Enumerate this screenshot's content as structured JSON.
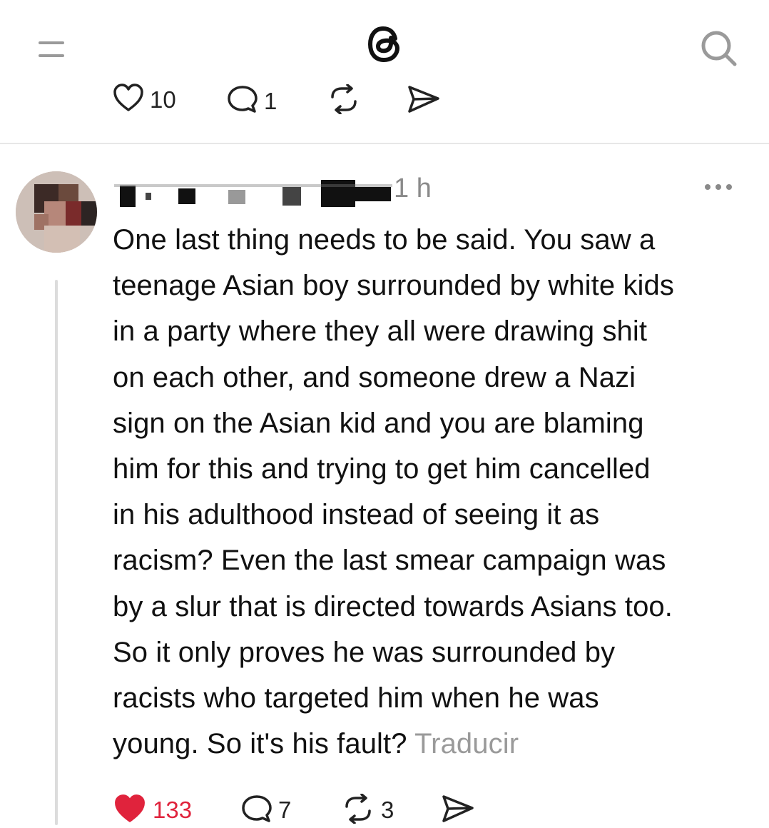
{
  "header": {
    "menu_icon": "menu-icon",
    "logo_icon": "threads-logo-icon",
    "search_icon": "search-icon"
  },
  "previous_post": {
    "likes": "10",
    "replies": "1",
    "repost_icon": "repost-icon",
    "share_icon": "share-icon"
  },
  "post": {
    "time": "1 h",
    "text_main": "One last thing needs to be said. You saw a\nteenage Asian boy surrounded by white kids\nin a party where they all were drawing shit\non each other, and someone drew a Nazi\nsign on the Asian kid and you are blaming\nhim for this and trying to get him cancelled\nin his adulthood instead of seeing it as\nracism? Even the last smear campaign was\nby a slur that is directed towards Asians too.\nSo it only proves he was surrounded by\nracists who targeted him when he was\nyoung. So it's his fault? ",
    "translate_label": "Traducir",
    "likes": "133",
    "replies": "7",
    "reposts": "3",
    "liked": true
  },
  "colors": {
    "liked_red": "#e0233c",
    "muted_gray": "#8a8a8a",
    "text": "#111111"
  }
}
